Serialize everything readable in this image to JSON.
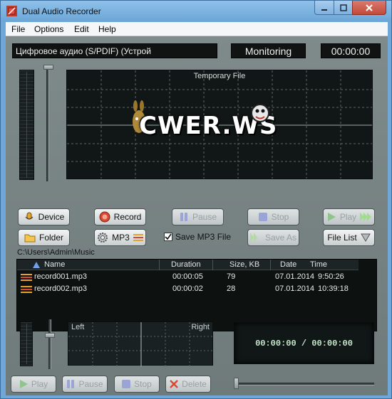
{
  "window": {
    "title": "Dual Audio Recorder",
    "controls": [
      "minimize",
      "maximize",
      "close"
    ]
  },
  "menu": [
    "File",
    "Options",
    "Edit",
    "Help"
  ],
  "display": {
    "device": "Цифровое аудио (S/PDIF) (Устрой",
    "status": "Monitoring",
    "time": "00:00:00"
  },
  "scope": {
    "title": "Temporary File",
    "watermark": "CWER.WS"
  },
  "buttons_row1": {
    "device": "Device",
    "record": "Record",
    "pause": "Pause",
    "stop": "Stop",
    "play": "Play"
  },
  "buttons_row2": {
    "folder": "Folder",
    "mp3": "MP3",
    "save_mp3_label": "Save MP3 File",
    "save_mp3_checked": true,
    "save_as": "Save As",
    "file_list": "File List"
  },
  "path": "C:\\Users\\Admin\\Music",
  "file_table": {
    "columns": [
      "Name",
      "Duration",
      "Size, KB",
      "Date",
      "Time"
    ],
    "rows": [
      {
        "name": "record001.mp3",
        "duration": "00:00:05",
        "size": "79",
        "date": "07.01.2014",
        "time": "9:50:26"
      },
      {
        "name": "record002.mp3",
        "duration": "00:00:02",
        "size": "28",
        "date": "07.01.2014",
        "time": "10:39:18"
      }
    ]
  },
  "player": {
    "left_label": "Left",
    "right_label": "Right",
    "time_readout": "00:00:00 / 00:00:00",
    "play": "Play",
    "pause": "Pause",
    "stop": "Stop",
    "delete": "Delete"
  },
  "colors": {
    "titlebar": "#7fb4e2",
    "panel": "#77827f",
    "lcd_bg": "#111716",
    "record_accent": "#d9482f",
    "play_accent": "#4fbf3a",
    "file_icon_accent": "#e8a12a"
  },
  "icons": {
    "device": "microphone-icon",
    "record": "record-circle-icon",
    "pause": "pause-icon",
    "stop": "stop-square-icon",
    "play": "play-triangle-icon",
    "folder": "folder-icon",
    "mp3": "gear-icon",
    "save_as": "save-icon",
    "file_list": "chevron-down-icon",
    "delete": "x-icon"
  }
}
